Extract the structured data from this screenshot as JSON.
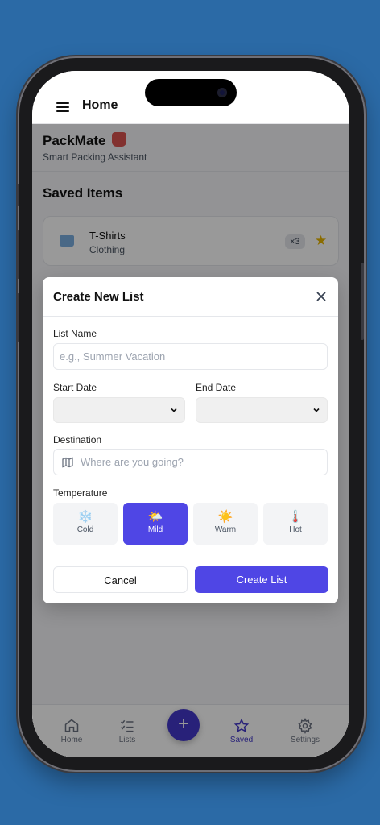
{
  "topbar": {
    "title": "Home"
  },
  "brand": {
    "title": "PackMate",
    "subtitle": "Smart Packing Assistant"
  },
  "saved": {
    "title": "Saved Items",
    "items": [
      {
        "name": "T-Shirts",
        "category": "Clothing",
        "quantity": "×3",
        "icon": "tshirt-icon",
        "starred": true
      }
    ]
  },
  "modal": {
    "title": "Create New List",
    "list_name_label": "List Name",
    "list_name_placeholder": "e.g., Summer Vacation",
    "start_date_label": "Start Date",
    "end_date_label": "End Date",
    "destination_label": "Destination",
    "destination_placeholder": "Where are you going?",
    "temperature_label": "Temperature",
    "temperatures": [
      {
        "label": "Cold",
        "glyph": "❄️",
        "icon": "snowflake-icon",
        "selected": false
      },
      {
        "label": "Mild",
        "glyph": "🌤️",
        "icon": "sun-cloud-icon",
        "selected": true
      },
      {
        "label": "Warm",
        "glyph": "☀️",
        "icon": "sun-icon",
        "selected": false
      },
      {
        "label": "Hot",
        "glyph": "🌡️",
        "icon": "thermometer-icon",
        "selected": false
      }
    ],
    "cancel_label": "Cancel",
    "create_label": "Create List"
  },
  "nav": {
    "items": [
      {
        "label": "Home",
        "icon": "home-icon",
        "active": false
      },
      {
        "label": "Lists",
        "icon": "checklist-icon",
        "active": false
      },
      {
        "label": "Saved",
        "icon": "star-icon",
        "active": true
      },
      {
        "label": "Settings",
        "icon": "gear-icon",
        "active": false
      }
    ],
    "fab_label": "+"
  },
  "colors": {
    "accent": "#4f46e5",
    "nav_active": "#4338ca",
    "background": "#2b6aa6",
    "star": "#e6b400"
  }
}
